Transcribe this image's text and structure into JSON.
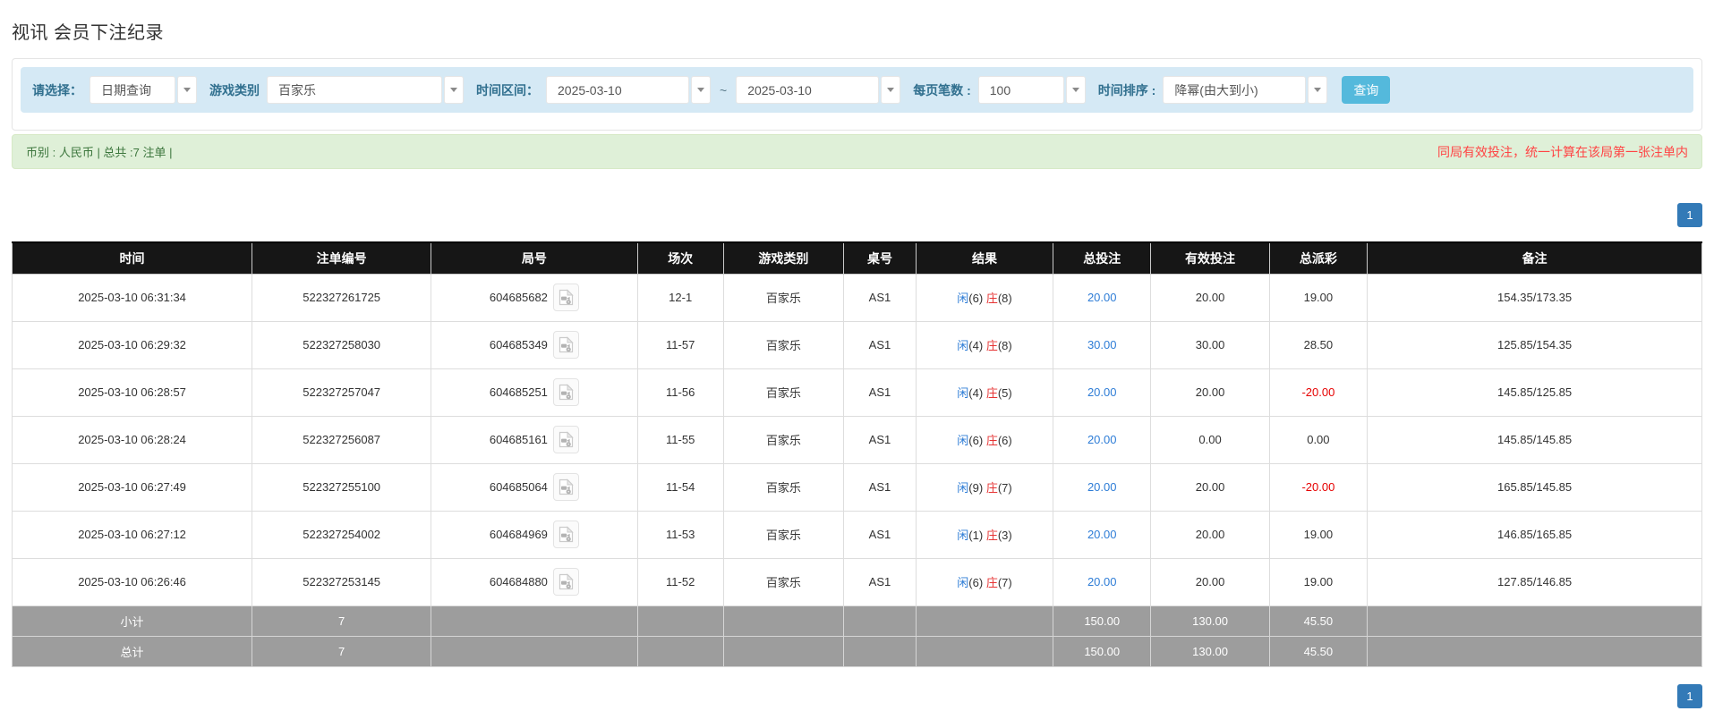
{
  "title": "视讯 会员下注纪录",
  "filters": {
    "select_label": "请选择：",
    "select_value": "日期查询",
    "game_type_label": "游戏类别",
    "game_type_value": "百家乐",
    "date_range_label": "时间区间：",
    "date_from": "2025-03-10",
    "date_separator": "~",
    "date_to": "2025-03-10",
    "page_size_label": "每页笔数 :",
    "page_size_value": "100",
    "sort_label": "时间排序 :",
    "sort_value": "降幂(由大到小)",
    "query_button": "查询"
  },
  "summary": {
    "left": "币别 : 人民币 | 总共 :7 注单 |",
    "note": "同局有效投注，统一计算在该局第一张注单内"
  },
  "pagination": {
    "page": "1"
  },
  "icons": {
    "combo_caret": "caret-down triangle",
    "video_replay": "file with video camera and film reel"
  },
  "colors": {
    "filter_bar_bg": "#d5e9f5",
    "filter_label": "#31708f",
    "query_button": "#54b9dc",
    "summary_bg": "#dff0d8",
    "summary_text": "#3c763d",
    "summary_note": "#ff4444",
    "header_bg": "#161616",
    "footer_bg": "#9d9d9d",
    "link_blue": "#2d7cd6",
    "banker_red": "#e63333",
    "negative_red": "#e60000",
    "pagination_blue": "#337ab7"
  },
  "table": {
    "headers": [
      "时间",
      "注单编号",
      "局号",
      "场次",
      "游戏类别",
      "桌号",
      "结果",
      "总投注",
      "有效投注",
      "总派彩",
      "备注"
    ],
    "result_labels": {
      "player": "闲",
      "banker": "庄"
    },
    "rows": [
      {
        "time": "2025-03-10 06:31:34",
        "bet_id": "522327261725",
        "round": "604685682",
        "session": "12-1",
        "game": "百家乐",
        "table": "AS1",
        "player": "6",
        "banker": "8",
        "total_bet": "20.00",
        "valid_bet": "20.00",
        "payout": "19.00",
        "note": "154.35/173.35"
      },
      {
        "time": "2025-03-10 06:29:32",
        "bet_id": "522327258030",
        "round": "604685349",
        "session": "11-57",
        "game": "百家乐",
        "table": "AS1",
        "player": "4",
        "banker": "8",
        "total_bet": "30.00",
        "valid_bet": "30.00",
        "payout": "28.50",
        "note": "125.85/154.35"
      },
      {
        "time": "2025-03-10 06:28:57",
        "bet_id": "522327257047",
        "round": "604685251",
        "session": "11-56",
        "game": "百家乐",
        "table": "AS1",
        "player": "4",
        "banker": "5",
        "total_bet": "20.00",
        "valid_bet": "20.00",
        "payout": "-20.00",
        "note": "145.85/125.85"
      },
      {
        "time": "2025-03-10 06:28:24",
        "bet_id": "522327256087",
        "round": "604685161",
        "session": "11-55",
        "game": "百家乐",
        "table": "AS1",
        "player": "6",
        "banker": "6",
        "total_bet": "20.00",
        "valid_bet": "0.00",
        "payout": "0.00",
        "note": "145.85/145.85"
      },
      {
        "time": "2025-03-10 06:27:49",
        "bet_id": "522327255100",
        "round": "604685064",
        "session": "11-54",
        "game": "百家乐",
        "table": "AS1",
        "player": "9",
        "banker": "7",
        "total_bet": "20.00",
        "valid_bet": "20.00",
        "payout": "-20.00",
        "note": "165.85/145.85"
      },
      {
        "time": "2025-03-10 06:27:12",
        "bet_id": "522327254002",
        "round": "604684969",
        "session": "11-53",
        "game": "百家乐",
        "table": "AS1",
        "player": "1",
        "banker": "3",
        "total_bet": "20.00",
        "valid_bet": "20.00",
        "payout": "19.00",
        "note": "146.85/165.85"
      },
      {
        "time": "2025-03-10 06:26:46",
        "bet_id": "522327253145",
        "round": "604684880",
        "session": "11-52",
        "game": "百家乐",
        "table": "AS1",
        "player": "6",
        "banker": "7",
        "total_bet": "20.00",
        "valid_bet": "20.00",
        "payout": "19.00",
        "note": "127.85/146.85"
      }
    ],
    "subtotal": {
      "label": "小计",
      "count": "7",
      "total_bet": "150.00",
      "valid_bet": "130.00",
      "payout": "45.50"
    },
    "total": {
      "label": "总计",
      "count": "7",
      "total_bet": "150.00",
      "valid_bet": "130.00",
      "payout": "45.50"
    }
  }
}
